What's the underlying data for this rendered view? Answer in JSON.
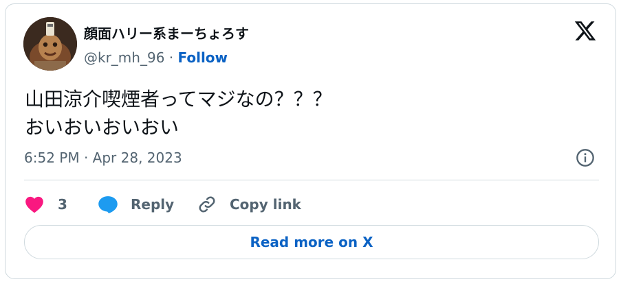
{
  "author": {
    "display_name": "顔面ハリー系まーちょろす",
    "handle": "@kr_mh_96",
    "separator": "·",
    "follow_label": "Follow"
  },
  "tweet": {
    "text_line_1": "山田涼介喫煙者ってマジなの？？？",
    "text_line_2": "おいおいおいおい",
    "timestamp": "6:52 PM · Apr 28, 2023"
  },
  "actions": {
    "like_count": "3",
    "reply_label": "Reply",
    "copy_link_label": "Copy link"
  },
  "read_more_label": "Read more on X",
  "icons": {
    "brand": "x-logo-icon",
    "info": "info-icon",
    "like": "heart-icon",
    "reply": "speech-bubble-icon",
    "copy": "link-icon"
  },
  "colors": {
    "like": "#f91880",
    "reply": "#1d9bf0",
    "link": "#0b62c4",
    "secondary_text": "#536471",
    "border": "#cfd9de"
  }
}
